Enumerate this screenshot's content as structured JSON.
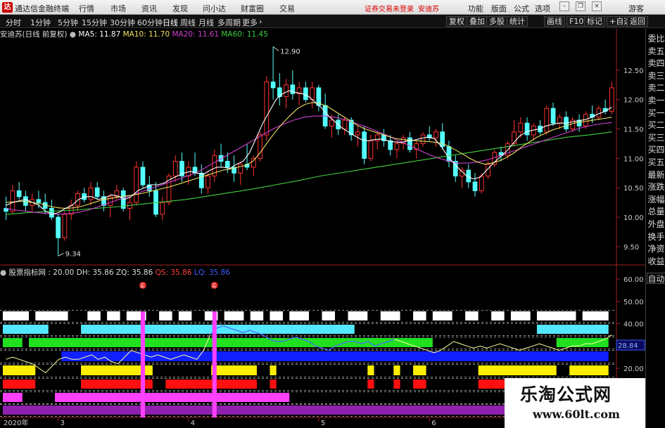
{
  "titlebar": {
    "app_title": "通达信金融终端",
    "logo_icon": "tdx-logo-icon",
    "menus": [
      "行情",
      "市场",
      "资讯",
      "发现",
      "问小达",
      "财富圈",
      "交易"
    ],
    "login_notice": "证券交易未登录",
    "stock_name": "安迪苏",
    "right_menus": [
      "功能",
      "版面",
      "公式",
      "选项"
    ],
    "guest": "游客"
  },
  "toolbar": {
    "periods": [
      "分时",
      "1分钟",
      "5分钟",
      "15分钟",
      "30分钟",
      "60分钟",
      "日线",
      "周线",
      "月线",
      "多周期",
      "更多"
    ],
    "active_period": "日线",
    "tools": [
      "复权",
      "叠加",
      "多股",
      "统计",
      "画线",
      "F10",
      "标记",
      "+自选",
      "返回"
    ]
  },
  "main_info": {
    "stock": "安迪苏(日线 前复权)",
    "ma5": "MA5: 11.87",
    "ma10": "MA10: 11.70",
    "ma20": "MA20: 11.61",
    "ma60": "MA60: 11.45",
    "ma_colors": {
      "ma5": "#ffffff",
      "ma10": "#f0e060",
      "ma20": "#d040d0",
      "ma60": "#40d040"
    }
  },
  "price_axis": [
    "12.50",
    "12.00",
    "11.50",
    "11.00",
    "10.50",
    "10.00",
    "9.50"
  ],
  "price_high_label": "12.90",
  "price_low_label": "9.34",
  "indicator_info": {
    "name": "股票指标网",
    "value": ": 20.00",
    "dh": "DH: 35.86",
    "zq": "ZQ: 35.86",
    "qs": "QS: 35.86",
    "lq": "LQ: 35.86"
  },
  "indicator_axis": [
    "60.00",
    "50.00",
    "40.00",
    "30.00",
    "20.00"
  ],
  "indicator_current": "28.84",
  "date_axis": [
    "2020年",
    "3",
    "4",
    "5",
    "6"
  ],
  "signal_labels": [
    "买",
    "买"
  ],
  "right_panel": [
    "委比",
    "卖五",
    "卖四",
    "卖三",
    "卖二",
    "卖一",
    "买一",
    "买二",
    "买三",
    "买四",
    "买五",
    "最新",
    "涨跌",
    "涨幅",
    "总量",
    "外盘",
    "换手",
    "净资",
    "收益",
    "自动"
  ],
  "watermark": {
    "title": "乐淘公式网",
    "url": "www.60lt.com"
  },
  "chart_data": {
    "type": "candlestick",
    "ylim": [
      9.2,
      13.0
    ],
    "up_color": "#ff3232",
    "down_color": "#54ffff",
    "candles": [
      [
        10.15,
        10.35,
        9.95,
        10.1
      ],
      [
        10.1,
        10.55,
        10.05,
        10.45
      ],
      [
        10.45,
        10.6,
        10.3,
        10.35
      ],
      [
        10.35,
        10.45,
        10.1,
        10.2
      ],
      [
        10.2,
        10.4,
        10.1,
        10.3
      ],
      [
        10.3,
        10.45,
        10.15,
        10.25
      ],
      [
        10.25,
        10.4,
        10.05,
        10.15
      ],
      [
        10.15,
        10.3,
        9.95,
        10.0
      ],
      [
        10.0,
        10.05,
        9.34,
        9.65
      ],
      [
        9.65,
        10.1,
        9.6,
        10.05
      ],
      [
        10.05,
        10.3,
        9.95,
        10.2
      ],
      [
        10.2,
        10.45,
        10.1,
        10.4
      ],
      [
        10.4,
        10.5,
        10.25,
        10.3
      ],
      [
        10.3,
        10.6,
        10.2,
        10.5
      ],
      [
        10.5,
        10.6,
        10.3,
        10.35
      ],
      [
        10.35,
        10.45,
        10.1,
        10.2
      ],
      [
        10.2,
        10.4,
        10.0,
        10.35
      ],
      [
        10.35,
        10.55,
        10.3,
        10.45
      ],
      [
        10.45,
        10.5,
        10.1,
        10.15
      ],
      [
        10.15,
        10.35,
        9.95,
        10.25
      ],
      [
        10.25,
        10.95,
        10.2,
        10.85
      ],
      [
        10.85,
        10.95,
        10.5,
        10.55
      ],
      [
        10.55,
        10.7,
        10.35,
        10.45
      ],
      [
        10.45,
        10.6,
        10.0,
        10.05
      ],
      [
        10.05,
        10.35,
        9.95,
        10.25
      ],
      [
        10.25,
        10.75,
        10.2,
        10.7
      ],
      [
        10.7,
        11.05,
        10.6,
        10.95
      ],
      [
        10.95,
        11.1,
        10.6,
        10.7
      ],
      [
        10.7,
        10.95,
        10.55,
        10.85
      ],
      [
        10.85,
        11.1,
        10.7,
        10.75
      ],
      [
        10.75,
        10.9,
        10.4,
        10.5
      ],
      [
        10.5,
        10.75,
        10.4,
        10.7
      ],
      [
        10.7,
        11.15,
        10.6,
        11.05
      ],
      [
        11.05,
        11.25,
        10.85,
        10.95
      ],
      [
        10.95,
        11.1,
        10.75,
        10.85
      ],
      [
        10.85,
        11.05,
        10.6,
        10.75
      ],
      [
        10.75,
        10.95,
        10.55,
        10.9
      ],
      [
        10.9,
        11.25,
        10.8,
        10.85
      ],
      [
        10.85,
        11.05,
        10.7,
        11.0
      ],
      [
        11.0,
        11.45,
        10.95,
        11.4
      ],
      [
        11.4,
        12.4,
        11.3,
        12.3
      ],
      [
        12.3,
        12.9,
        12.0,
        12.2
      ],
      [
        12.2,
        12.45,
        11.9,
        12.05
      ],
      [
        12.05,
        12.35,
        11.85,
        12.25
      ],
      [
        12.25,
        12.5,
        12.0,
        12.1
      ],
      [
        12.1,
        12.3,
        11.9,
        12.2
      ],
      [
        12.2,
        12.3,
        11.95,
        12.0
      ],
      [
        12.0,
        12.3,
        11.85,
        12.2
      ],
      [
        12.2,
        12.25,
        11.8,
        11.9
      ],
      [
        11.9,
        12.1,
        11.5,
        11.55
      ],
      [
        11.55,
        11.75,
        11.35,
        11.65
      ],
      [
        11.65,
        11.75,
        11.4,
        11.5
      ],
      [
        11.5,
        11.7,
        11.4,
        11.65
      ],
      [
        11.65,
        11.7,
        11.3,
        11.4
      ],
      [
        11.4,
        11.55,
        11.2,
        11.45
      ],
      [
        11.45,
        11.55,
        10.9,
        11.0
      ],
      [
        11.0,
        11.4,
        10.95,
        11.3
      ],
      [
        11.3,
        11.45,
        11.15,
        11.4
      ],
      [
        11.4,
        11.5,
        11.2,
        11.3
      ],
      [
        11.3,
        11.4,
        11.05,
        11.15
      ],
      [
        11.15,
        11.3,
        11.0,
        11.25
      ],
      [
        11.25,
        11.4,
        11.15,
        11.35
      ],
      [
        11.35,
        11.45,
        11.1,
        11.15
      ],
      [
        11.15,
        11.3,
        11.0,
        11.25
      ],
      [
        11.25,
        11.45,
        11.2,
        11.4
      ],
      [
        11.4,
        11.55,
        11.3,
        11.35
      ],
      [
        11.35,
        11.5,
        11.2,
        11.45
      ],
      [
        11.45,
        11.6,
        11.15,
        11.2
      ],
      [
        11.2,
        11.3,
        10.85,
        10.95
      ],
      [
        10.95,
        11.05,
        10.6,
        10.7
      ],
      [
        10.7,
        10.85,
        10.5,
        10.8
      ],
      [
        10.8,
        10.9,
        10.5,
        10.6
      ],
      [
        10.6,
        10.75,
        10.35,
        10.45
      ],
      [
        10.45,
        10.75,
        10.4,
        10.7
      ],
      [
        10.7,
        10.95,
        10.65,
        10.9
      ],
      [
        10.9,
        11.15,
        10.85,
        11.1
      ],
      [
        11.1,
        11.2,
        10.95,
        11.05
      ],
      [
        11.05,
        11.3,
        11.0,
        11.25
      ],
      [
        11.25,
        11.65,
        11.2,
        11.45
      ],
      [
        11.45,
        11.7,
        11.35,
        11.6
      ],
      [
        11.6,
        11.7,
        11.3,
        11.4
      ],
      [
        11.4,
        11.6,
        11.3,
        11.55
      ],
      [
        11.55,
        11.65,
        11.4,
        11.45
      ],
      [
        11.45,
        11.9,
        11.4,
        11.85
      ],
      [
        11.85,
        11.95,
        11.55,
        11.6
      ],
      [
        11.6,
        11.75,
        11.5,
        11.7
      ],
      [
        11.7,
        11.8,
        11.45,
        11.5
      ],
      [
        11.5,
        11.7,
        11.45,
        11.65
      ],
      [
        11.65,
        11.75,
        11.45,
        11.55
      ],
      [
        11.55,
        11.8,
        11.5,
        11.75
      ],
      [
        11.75,
        11.9,
        11.6,
        11.7
      ],
      [
        11.7,
        11.9,
        11.65,
        11.85
      ],
      [
        11.85,
        12.0,
        11.75,
        11.8
      ],
      [
        11.8,
        12.3,
        11.75,
        12.2
      ]
    ],
    "ma5": [
      10.2,
      10.25,
      10.28,
      10.3,
      10.25,
      10.2,
      10.1,
      10.05,
      10.08,
      10.15,
      10.2,
      10.3,
      10.35,
      10.35,
      10.3,
      10.33,
      10.38,
      10.36,
      10.3,
      10.35,
      10.45,
      10.5,
      10.55,
      10.55,
      10.58,
      10.65,
      10.7,
      10.75,
      10.78,
      10.75,
      10.73,
      10.8,
      10.85,
      10.85,
      10.83,
      10.9,
      10.95,
      11.1,
      11.35,
      11.6,
      11.8,
      12.0,
      12.1,
      12.15,
      12.12,
      12.1,
      12.05,
      11.95,
      11.85,
      11.72,
      11.62,
      11.52,
      11.45,
      11.38,
      11.32,
      11.3,
      11.32,
      11.33,
      11.3,
      11.28,
      11.27,
      11.3,
      11.31,
      11.34,
      11.36,
      11.34,
      11.22,
      11.05,
      10.92,
      10.8,
      10.7,
      10.65,
      10.68,
      10.8,
      10.92,
      11.02,
      11.12,
      11.25,
      11.38,
      11.45,
      11.48,
      11.5,
      11.55,
      11.58,
      11.6,
      11.6,
      11.62,
      11.64,
      11.66,
      11.7,
      11.76,
      11.8,
      11.87
    ],
    "ma10": [
      10.25,
      10.26,
      10.27,
      10.26,
      10.24,
      10.22,
      10.18,
      10.16,
      10.15,
      10.16,
      10.18,
      10.22,
      10.26,
      10.3,
      10.32,
      10.34,
      10.36,
      10.38,
      10.4,
      10.43,
      10.46,
      10.49,
      10.52,
      10.56,
      10.6,
      10.64,
      10.68,
      10.72,
      10.76,
      10.8,
      10.82,
      10.85,
      10.88,
      10.95,
      11.1,
      11.28,
      11.45,
      11.6,
      11.73,
      11.85,
      11.92,
      11.95,
      11.93,
      11.88,
      11.8,
      11.72,
      11.64,
      11.56,
      11.5,
      11.46,
      11.42,
      11.38,
      11.34,
      11.32,
      11.31,
      11.3,
      11.29,
      11.28,
      11.26,
      11.22,
      11.15,
      11.08,
      11.0,
      10.94,
      10.9,
      10.92,
      10.96,
      11.02,
      11.1,
      11.2,
      11.28,
      11.36,
      11.42,
      11.48,
      11.52,
      11.56,
      11.6,
      11.62,
      11.64,
      11.66,
      11.68,
      11.7
    ],
    "ma20": [
      10.15,
      10.12,
      10.1,
      10.08,
      10.06,
      10.05,
      10.06,
      10.08,
      10.12,
      10.18,
      10.24,
      10.3,
      10.36,
      10.42,
      10.48,
      10.54,
      10.6,
      10.66,
      10.72,
      10.8,
      10.9,
      11.0,
      11.1,
      11.2,
      11.3,
      11.4,
      11.5,
      11.58,
      11.65,
      11.7,
      11.72,
      11.72,
      11.7,
      11.66,
      11.6,
      11.54,
      11.47,
      11.4,
      11.32,
      11.24,
      11.16,
      11.08,
      11.01,
      10.96,
      10.92,
      10.92,
      10.94,
      10.98,
      11.04,
      11.1,
      11.16,
      11.22,
      11.28,
      11.34,
      11.4,
      11.46,
      11.52,
      11.56,
      11.59,
      11.61
    ],
    "ma60": [
      10.05,
      10.08,
      10.1,
      10.12,
      10.15,
      10.18,
      10.22,
      10.26,
      10.3,
      10.36,
      10.42,
      10.48,
      10.55,
      10.62,
      10.7,
      10.76,
      10.82,
      10.88,
      10.94,
      11.0,
      11.06,
      11.12,
      11.18,
      11.24,
      11.3,
      11.36,
      11.4,
      11.45
    ]
  }
}
